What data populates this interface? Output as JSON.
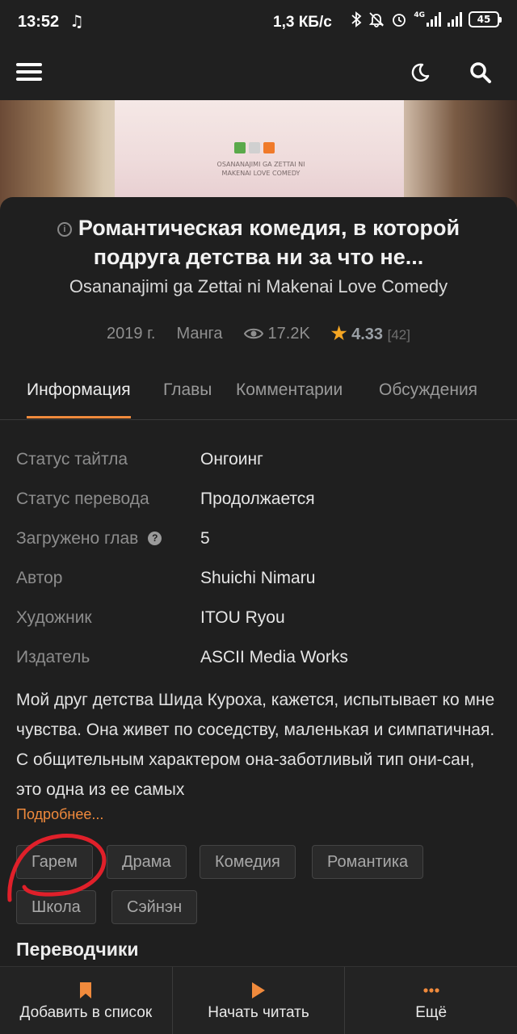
{
  "status_bar": {
    "time": "13:52",
    "net_speed": "1,3 КБ/с",
    "network_type": "4G",
    "battery": "45"
  },
  "app_bar": {
    "icons": [
      "menu-icon",
      "moon-icon",
      "search-icon"
    ]
  },
  "title": {
    "main": "Романтическая комедия, в которой подруга детства ни за что не...",
    "alternative": "Osananajimi ga Zettai ni Makenai Love Comedy"
  },
  "meta": {
    "year": "2019 г.",
    "type": "Манга",
    "views": "17.2K",
    "rating": "4.33",
    "votes": "[42]"
  },
  "tabs": [
    {
      "label": "Информация",
      "active": true
    },
    {
      "label": "Главы",
      "active": false
    },
    {
      "label": "Комментарии",
      "active": false
    },
    {
      "label": "Обсуждения",
      "active": false
    }
  ],
  "info": [
    {
      "key": "Статус тайтла",
      "value": "Онгоинг"
    },
    {
      "key": "Статус перевода",
      "value": "Продолжается"
    },
    {
      "key": "Загружено глав",
      "value": "5"
    },
    {
      "key": "Автор",
      "value": "Shuichi Nimaru"
    },
    {
      "key": "Художник",
      "value": "ITOU Ryou"
    },
    {
      "key": "Издатель",
      "value": "ASCII Media Works"
    }
  ],
  "description": "Мой друг детства Шида Куроха, кажется, испытывает ко мне чувства. Она живет по соседству, маленькая и симпатичная. С общительным характером она-заботливый тип они-сан, это одна из ее самых",
  "more_link": "Подробнее...",
  "tags": [
    "Гарем",
    "Драма",
    "Комедия",
    "Романтика",
    "Школа",
    "Сэйнэн"
  ],
  "section_translators": "Переводчики",
  "bottom_bar": {
    "add": "Добавить в список",
    "read": "Начать читать",
    "more": "Ещё"
  },
  "colors": {
    "accent": "#f08a3c",
    "star": "#f5a623",
    "annotation": "#e0202a",
    "background": "#1f1f1f"
  },
  "cover_art": {
    "text": "OSANANAJIMI GA ZETTAI NI MAKENAI LOVE COMEDY"
  }
}
